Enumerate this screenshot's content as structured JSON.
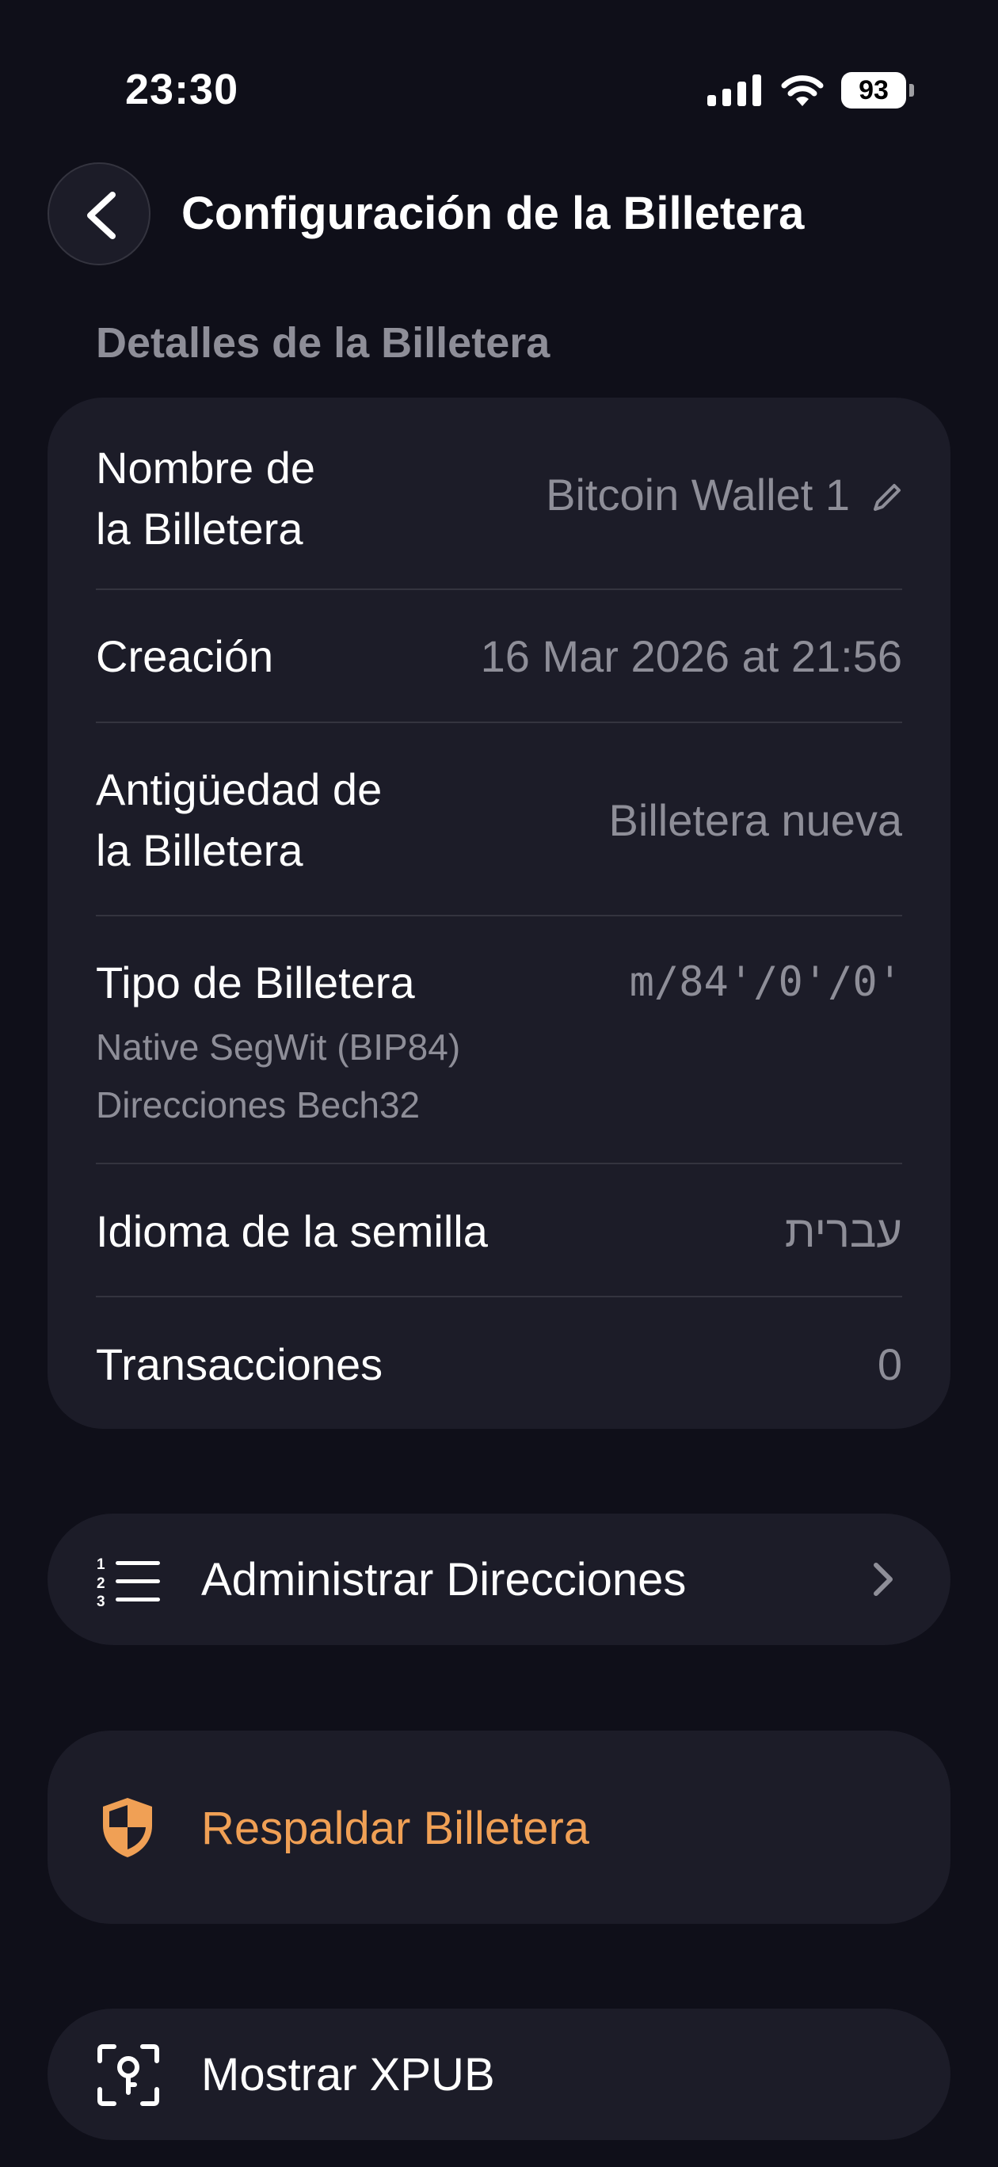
{
  "status_bar": {
    "time": "23:30",
    "battery_level": "93"
  },
  "header": {
    "title": "Configuración de la Billetera"
  },
  "details": {
    "section_title": "Detalles de la Billetera",
    "wallet_name_label_line1": "Nombre de",
    "wallet_name_label_line2": "la Billetera",
    "wallet_name_value": "Bitcoin Wallet 1",
    "created_label": "Creación",
    "created_value": "16 Mar 2026 at 21:56",
    "age_label_line1": "Antigüedad de",
    "age_label_line2": "la Billetera",
    "age_value": "Billetera nueva",
    "type_label": "Tipo de Billetera",
    "type_value": "m/84'/0'/0'",
    "type_sub1": "Native SegWit (BIP84)",
    "type_sub2": "Direcciones Bech32",
    "seed_lang_label": "Idioma de la semilla",
    "seed_lang_value": "עברית",
    "tx_label": "Transacciones",
    "tx_value": "0"
  },
  "actions": {
    "manage_addresses": "Administrar Direcciones",
    "backup_wallet": "Respaldar Billetera",
    "show_xpub": "Mostrar XPUB"
  },
  "colors": {
    "background": "#0f0f19",
    "card": "#1c1c28",
    "accent": "#f0a055",
    "secondary_text": "#8e8e98"
  }
}
